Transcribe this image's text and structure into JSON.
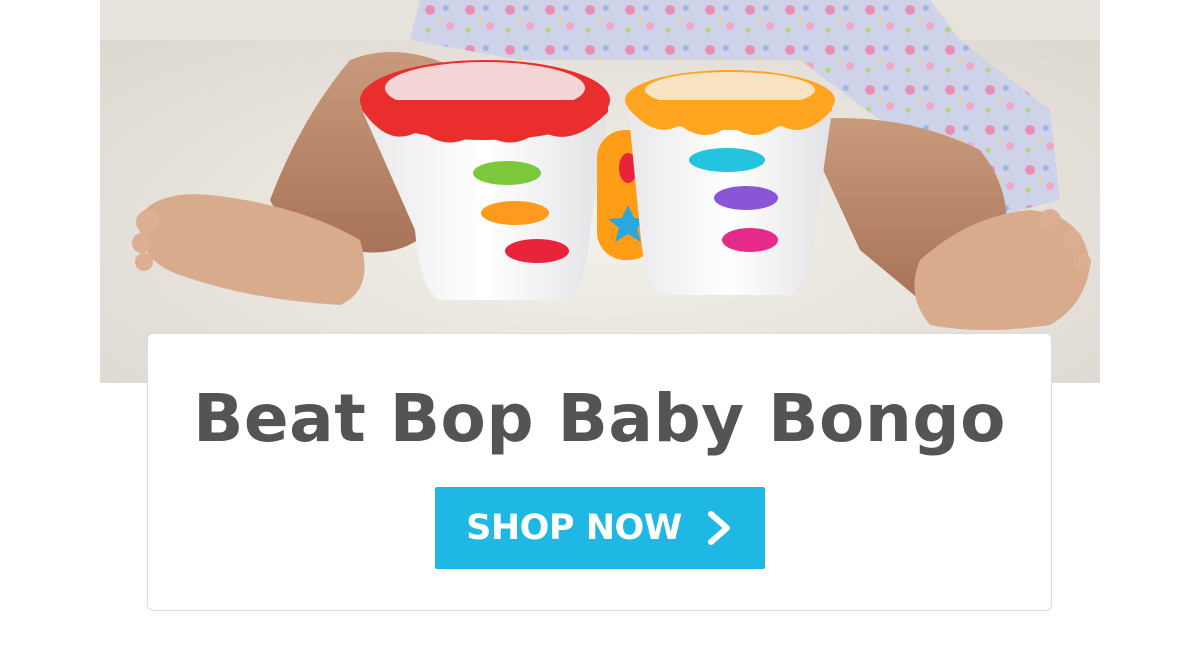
{
  "hero": {
    "image": "baby-with-bongo-toy-photo"
  },
  "banner": {
    "title": "Beat Bop Baby Bongo",
    "cta_label": "SHOP NOW",
    "cta_icon": "chevron-right-icon"
  },
  "colors": {
    "title_text": "#545457",
    "cta_background": "#1fb7e3",
    "cta_text": "#ffffff",
    "card_border": "#dcdcdc"
  }
}
